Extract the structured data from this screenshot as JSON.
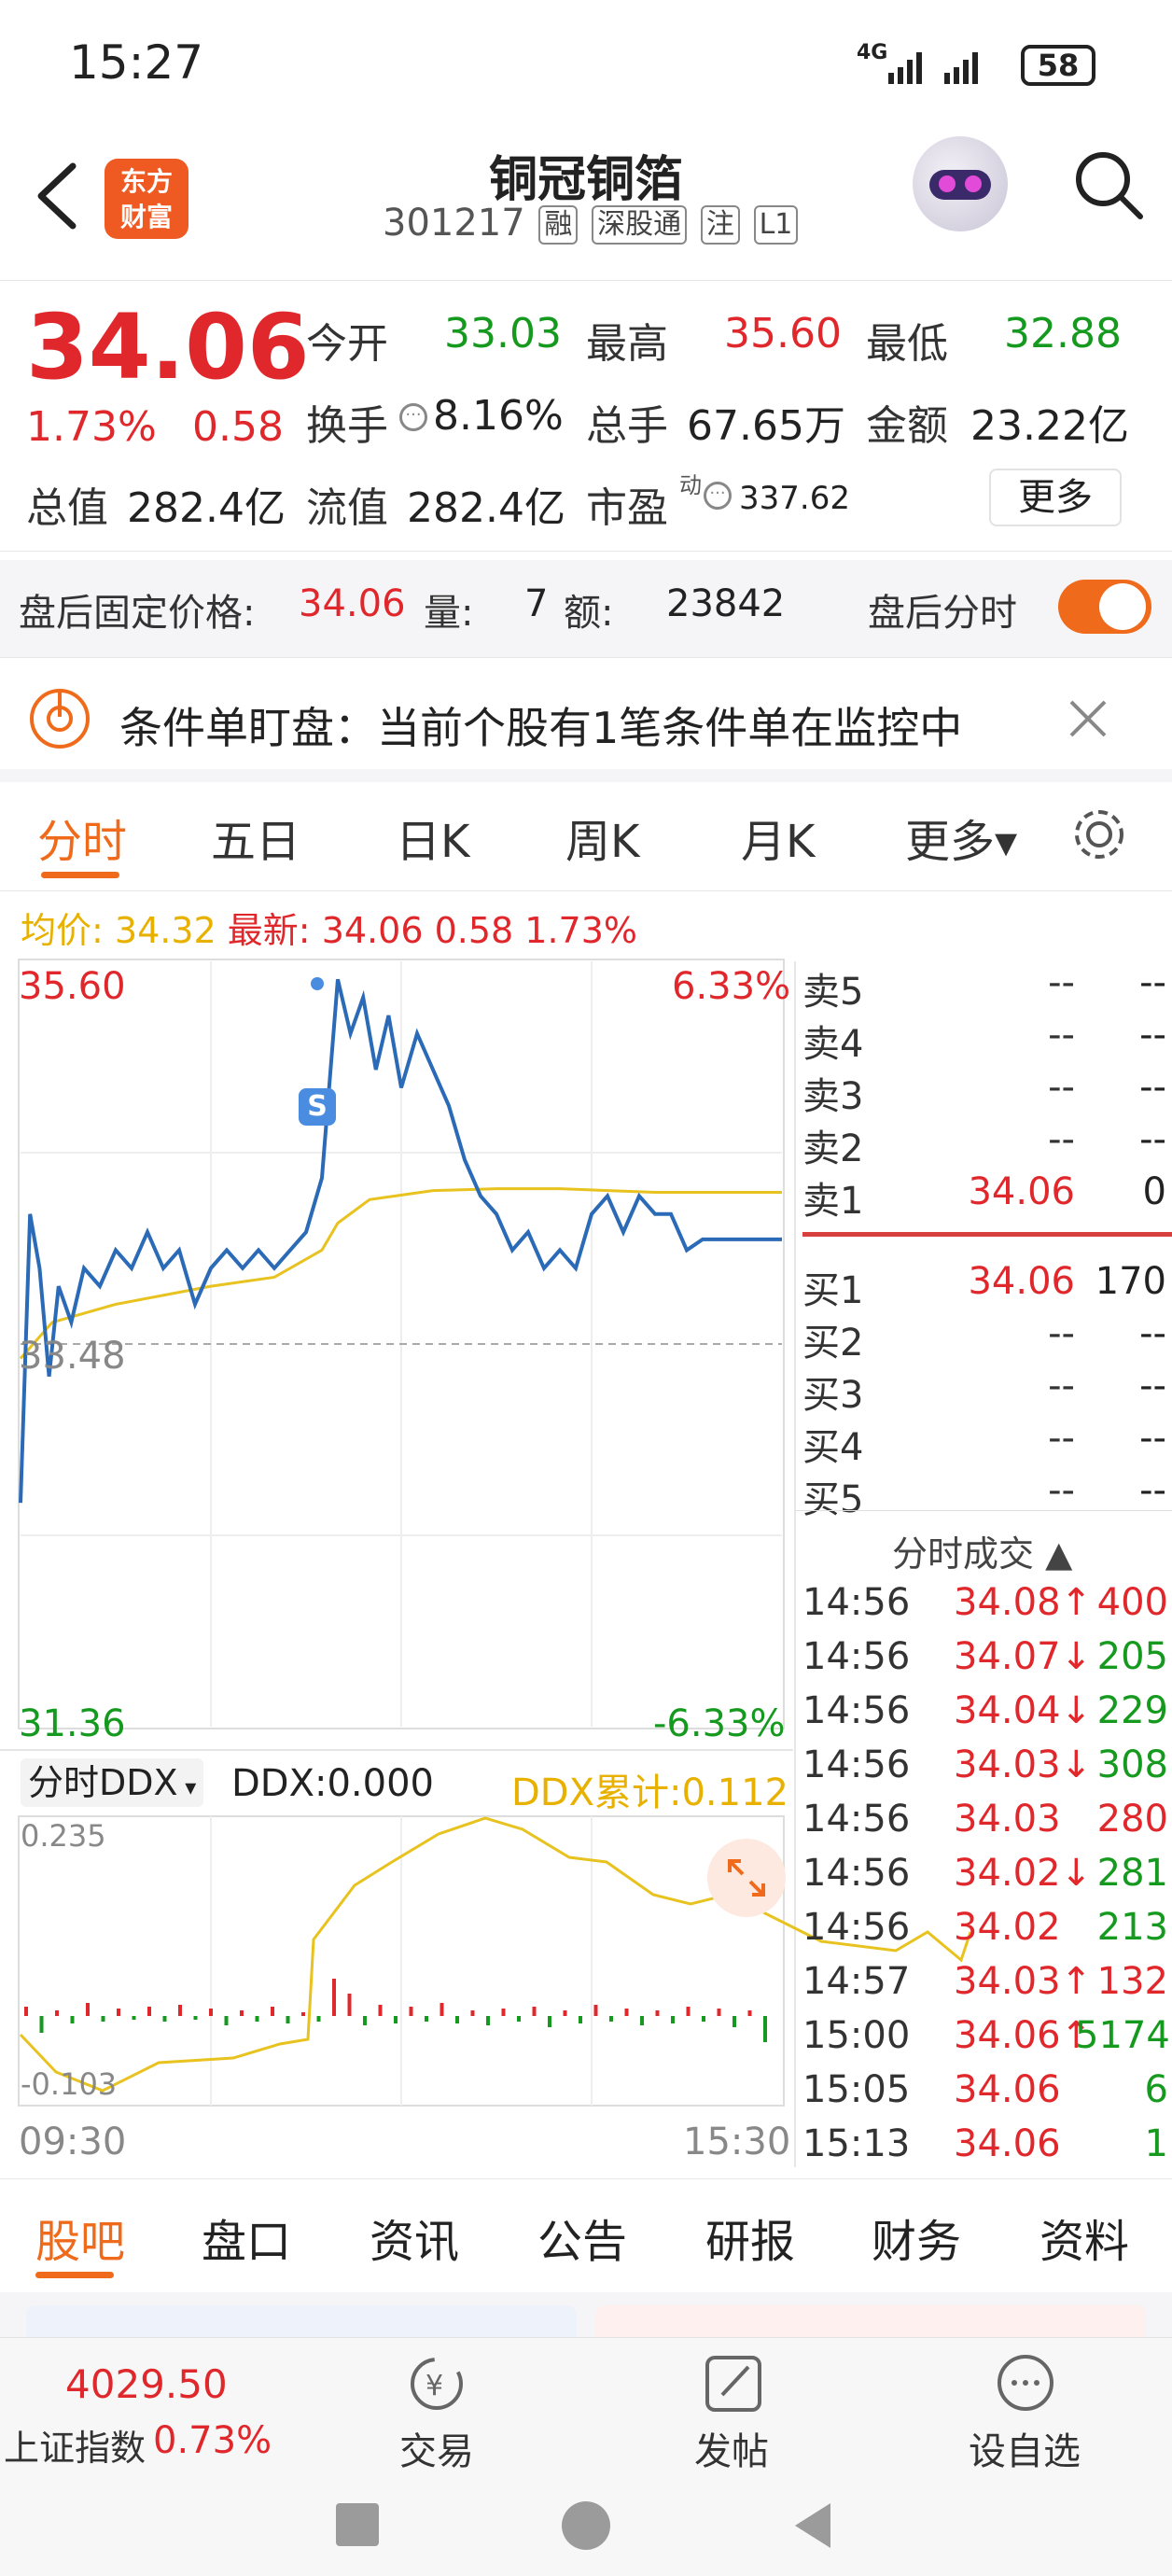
{
  "status": {
    "time": "15:27",
    "signal": "4G",
    "battery": "58"
  },
  "header": {
    "stock_name": "铜冠铜箔",
    "code": "301217",
    "tags": [
      "融",
      "深股通",
      "注",
      "L1"
    ],
    "logo_line1": "东方",
    "logo_line2": "财富"
  },
  "quote": {
    "price": "34.06",
    "pct": "1.73%",
    "change": "0.58",
    "open_label": "今开",
    "open": "33.03",
    "high_label": "最高",
    "high": "35.60",
    "low_label": "最低",
    "low": "32.88",
    "turnover_label": "换手",
    "turnover": "8.16%",
    "volume_label": "总手",
    "volume": "67.65万",
    "amount_label": "金额",
    "amount": "23.22亿",
    "mcap_label": "总值",
    "mcap": "282.4亿",
    "float_label": "流值",
    "float": "282.4亿",
    "pe_label": "市盈",
    "pe_sup": "动",
    "pe": "337.62",
    "more": "更多"
  },
  "after_hours": {
    "label": "盘后固定价格:",
    "price": "34.06",
    "vol_label": "量:",
    "vol": "7",
    "amt_label": "额:",
    "amt": "23842",
    "toggle_label": "盘后分时",
    "toggle_on": true
  },
  "condition": {
    "text": "条件单盯盘：当前个股有1笔条件单在监控中"
  },
  "tabs": [
    "分时",
    "五日",
    "日K",
    "周K",
    "月K",
    "更多▾"
  ],
  "avg": {
    "label": "均价:",
    "value": "34.32",
    "latest_label": "最新:",
    "latest": "34.06",
    "chg": "0.58",
    "pct": "1.73%"
  },
  "chart": {
    "top_left": "35.60",
    "top_right": "6.33%",
    "mid": "33.48",
    "bottom_left": "31.36",
    "bottom_right": "-6.33%",
    "s_marker": "S",
    "ddx_select": "分时DDX",
    "ddx_value": "DDX:0.000",
    "ddx_cum": "DDX累计:0.112",
    "ddx_top": "0.235",
    "ddx_bottom": "-0.103",
    "time_start": "09:30",
    "time_end": "15:30",
    "colors": {
      "price": "#2a6ab6",
      "avg": "#e8c21f",
      "up": "#e0282c",
      "down": "#159a1f"
    }
  },
  "chart_data": {
    "type": "line",
    "x_range": [
      "09:30",
      "15:30"
    ],
    "ylim": [
      31.36,
      35.6
    ],
    "prev_close": 33.48,
    "series": [
      {
        "name": "",
        "x": [
          0,
          3,
          6,
          9,
          12,
          16,
          20,
          25,
          30,
          35,
          40,
          45,
          50,
          55,
          60,
          65,
          70,
          75,
          80,
          85,
          90,
          95,
          100,
          104,
          108,
          112,
          116,
          120,
          125,
          130,
          135,
          140,
          145,
          150,
          155,
          160,
          165,
          170,
          175,
          180,
          185,
          190,
          195,
          200,
          205,
          210,
          215,
          220,
          225,
          230,
          235,
          240
        ],
        "values": [
          32.6,
          34.2,
          33.9,
          33.3,
          33.8,
          33.6,
          33.9,
          33.8,
          34.0,
          33.9,
          34.1,
          33.9,
          34.0,
          33.7,
          33.9,
          34.0,
          33.9,
          34.0,
          33.9,
          34.0,
          34.1,
          34.4,
          35.5,
          35.2,
          35.4,
          35.0,
          35.3,
          34.9,
          35.2,
          35.0,
          34.8,
          34.5,
          34.3,
          34.2,
          34.0,
          34.1,
          33.9,
          34.0,
          33.9,
          34.2,
          34.3,
          34.1,
          34.3,
          34.2,
          34.2,
          34.0,
          34.06,
          34.06,
          34.06,
          34.06,
          34.06,
          34.06
        ]
      },
      {
        "name": "",
        "x": [
          0,
          10,
          30,
          60,
          80,
          95,
          100,
          110,
          130,
          150,
          170,
          200,
          240
        ],
        "values": [
          33.4,
          33.6,
          33.7,
          33.8,
          33.85,
          34.0,
          34.15,
          34.28,
          34.33,
          34.34,
          34.34,
          34.32,
          34.32
        ]
      }
    ]
  },
  "orderbook": {
    "asks": [
      {
        "label": "卖5",
        "price": "--",
        "vol": "--"
      },
      {
        "label": "卖4",
        "price": "--",
        "vol": "--"
      },
      {
        "label": "卖3",
        "price": "--",
        "vol": "--"
      },
      {
        "label": "卖2",
        "price": "--",
        "vol": "--"
      },
      {
        "label": "卖1",
        "price": "34.06",
        "vol": "0"
      }
    ],
    "bids": [
      {
        "label": "买1",
        "price": "34.06",
        "vol": "170"
      },
      {
        "label": "买2",
        "price": "--",
        "vol": "--"
      },
      {
        "label": "买3",
        "price": "--",
        "vol": "--"
      },
      {
        "label": "买4",
        "price": "--",
        "vol": "--"
      },
      {
        "label": "买5",
        "price": "--",
        "vol": "--"
      }
    ],
    "trades_title": "分时成交 ▲",
    "trades": [
      {
        "t": "14:56",
        "p": "34.08↑",
        "v": "400",
        "dir": "up"
      },
      {
        "t": "14:56",
        "p": "34.07↓",
        "v": "205",
        "dir": "down"
      },
      {
        "t": "14:56",
        "p": "34.04↓",
        "v": "229",
        "dir": "down"
      },
      {
        "t": "14:56",
        "p": "34.03↓",
        "v": "308",
        "dir": "down"
      },
      {
        "t": "14:56",
        "p": "34.03",
        "v": "280",
        "dir": "up"
      },
      {
        "t": "14:56",
        "p": "34.02↓",
        "v": "281",
        "dir": "down"
      },
      {
        "t": "14:56",
        "p": "34.02",
        "v": "213",
        "dir": "down"
      },
      {
        "t": "14:57",
        "p": "34.03↑",
        "v": "132",
        "dir": "up"
      },
      {
        "t": "15:00",
        "p": "34.06↑",
        "v": "5174",
        "dir": "down"
      },
      {
        "t": "15:05",
        "p": "34.06",
        "v": "6",
        "dir": "down"
      },
      {
        "t": "15:13",
        "p": "34.06",
        "v": "1",
        "dir": "down"
      }
    ]
  },
  "bottom_tabs": [
    "股吧",
    "盘口",
    "资讯",
    "公告",
    "研报",
    "财务",
    "资料"
  ],
  "bottom_bar": {
    "index_value": "4029.50",
    "index_name": "上证指数",
    "index_pct": "0.73%",
    "trade": "交易",
    "post": "发帖",
    "watch": "设自选"
  }
}
